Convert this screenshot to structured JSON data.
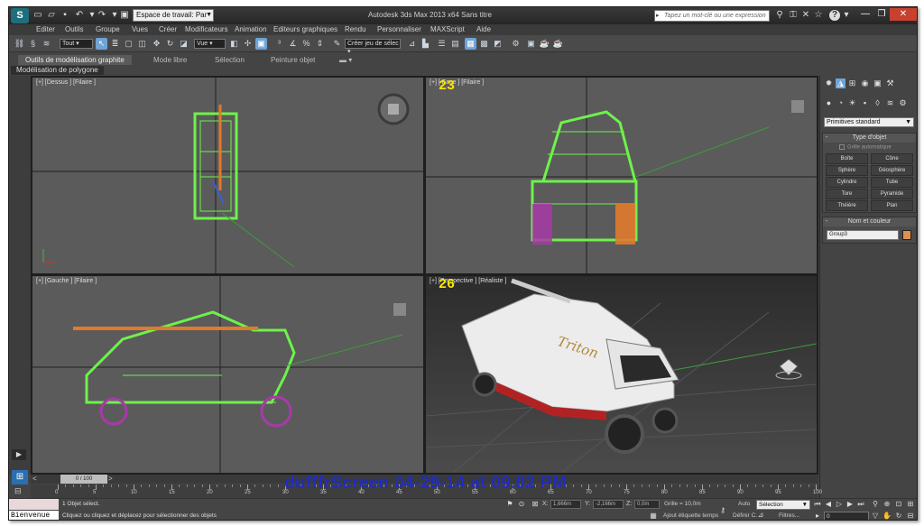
{
  "window": {
    "app_logo": "S",
    "workspace_label": "Espace de travail: Par",
    "title": "Autodesk 3ds Max  2013 x64     Sans titre",
    "help_search_placeholder": "Tapez un mot-clé ou une expression",
    "minimize": "—",
    "restore": "❐",
    "close": "✕"
  },
  "menu": [
    "Editer",
    "Outils",
    "Groupe",
    "Vues",
    "Créer",
    "Modificateurs",
    "Animation",
    "Editeurs graphiques",
    "Rendu",
    "Personnaliser",
    "MAXScript",
    "Aide"
  ],
  "toolbar": {
    "selection_filter": "Tout",
    "reference_coord": "Vue",
    "named_selection": "Créer jeu de sélec"
  },
  "ribbon": {
    "tabs": [
      "Outils de modélisation graphite",
      "Mode libre",
      "Sélection",
      "Peinture objet"
    ],
    "active_tab": 0,
    "subpanel": "Modélisation de polygone"
  },
  "viewports": {
    "top": {
      "label": "[+] [Dessus ] [Filaire ]"
    },
    "front": {
      "label": "[+] [ Face ] [Filaire ]",
      "overlay_number": "23"
    },
    "left": {
      "label": "[+] [Gauche ] [Filaire ]"
    },
    "perspective": {
      "label": "[+] [Perspective ] [Réaliste ]",
      "overlay_number": "26",
      "vehicle_brand": "Triton"
    }
  },
  "command_panel": {
    "category_dropdown": "Primitives standard",
    "rollout_object_type": {
      "title": "Type d'objet",
      "auto_grid": "Grille automatique",
      "buttons": [
        "Boîte",
        "Cône",
        "Sphère",
        "Géosphère",
        "Cylindre",
        "Tube",
        "Tore",
        "Pyramide",
        "Théière",
        "Plan"
      ]
    },
    "rollout_name_color": {
      "title": "Nom et couleur",
      "name_value": "Group3",
      "color": "#e0904a"
    }
  },
  "timeline": {
    "slider_text": "0 / 100",
    "ticks": [
      "0",
      "5",
      "10",
      "15",
      "20",
      "25",
      "30",
      "35",
      "40",
      "45",
      "50",
      "55",
      "60",
      "65",
      "70",
      "75",
      "80",
      "85",
      "90",
      "95",
      "100"
    ]
  },
  "status_bar": {
    "welcome": "Bienvenue",
    "line1": "1 Objet sélect.",
    "line2": "Cliquez ou cliquez et déplacez pour sélectionner des objets",
    "x_label": "X:",
    "x_value": "1,666m",
    "y_label": "Y:",
    "y_value": "-2,166m",
    "z_label": "Z:",
    "z_value": "0,0m",
    "grid": "Grille = 10,0m",
    "add_time_tag": "Ajout étiquette temps",
    "auto_label": "Auto",
    "auto_dropdown": "Sélection",
    "set_key": "Définir C.",
    "filters": "Filtres...",
    "frame_value": "0"
  },
  "watermark": "dufffrScreen 04-29-14 at 09.02 PM"
}
